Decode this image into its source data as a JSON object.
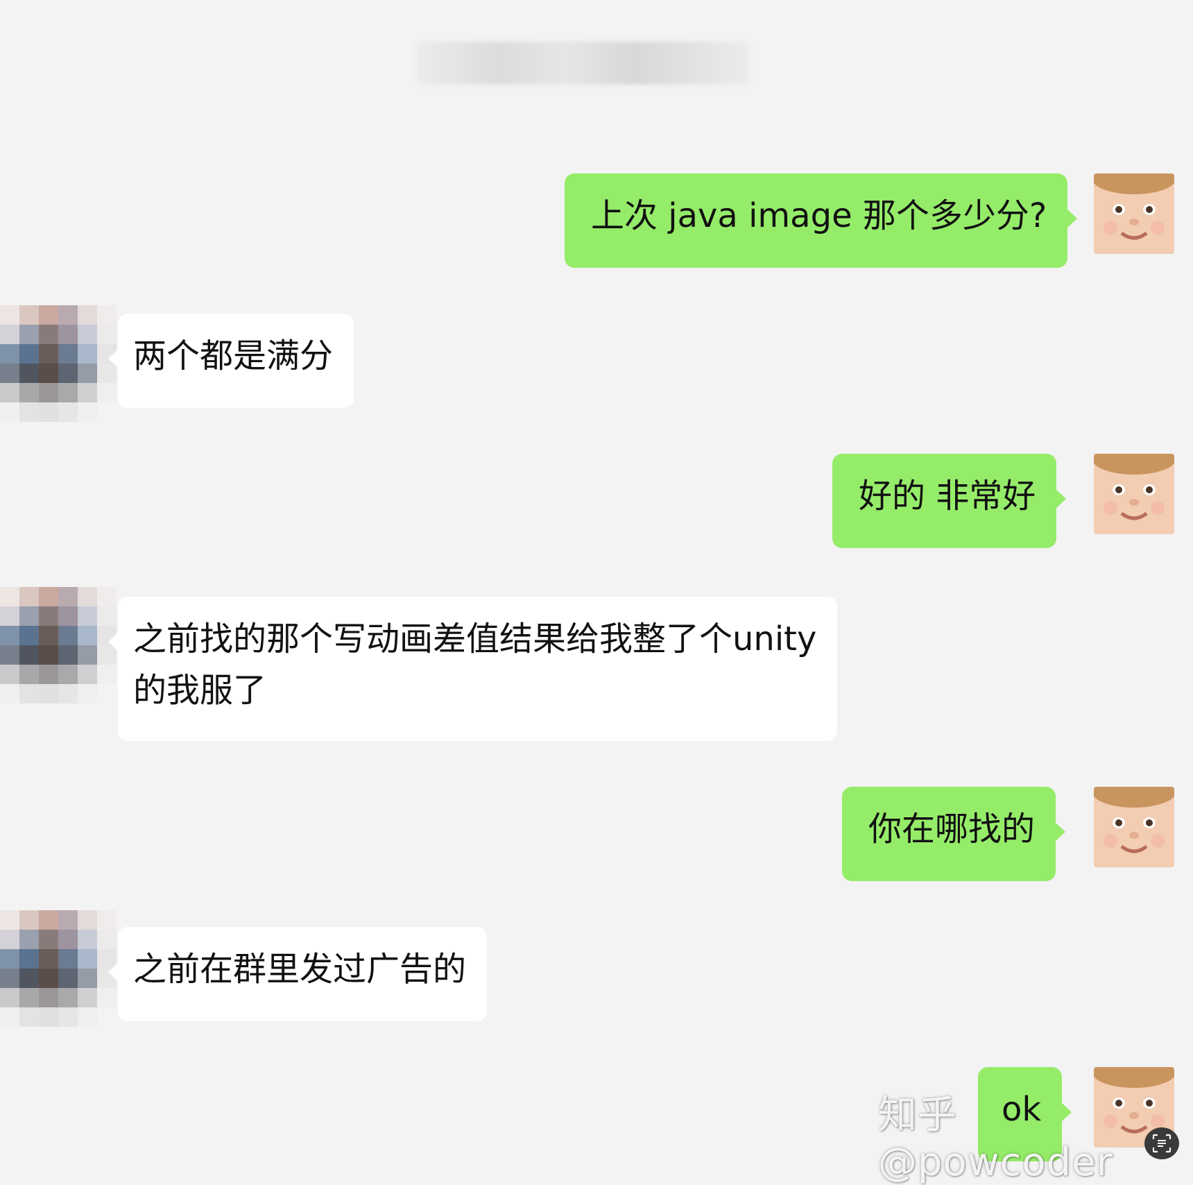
{
  "chat": {
    "messages": [
      {
        "side": "sent",
        "text": "上次 java image 那个多少分?"
      },
      {
        "side": "received",
        "text": "两个都是满分"
      },
      {
        "side": "sent",
        "text": "好的 非常好"
      },
      {
        "side": "received",
        "line1": "之前找的那个写动画差值结果给我整了个unity",
        "line2": "的我服了"
      },
      {
        "side": "sent",
        "text": "你在哪找的"
      },
      {
        "side": "received",
        "text": "之前在群里发过广告的"
      },
      {
        "side": "sent",
        "text": "ok"
      }
    ]
  },
  "watermark": {
    "text": "知乎 @powcoder"
  },
  "colors": {
    "background": "#f3f3f3",
    "sent_bubble": "#95ec69",
    "received_bubble": "#ffffff"
  },
  "icons": {
    "self_avatar": "baby-face-avatar",
    "other_avatar": "pixelated-avatar",
    "scan": "text-scan-icon"
  }
}
